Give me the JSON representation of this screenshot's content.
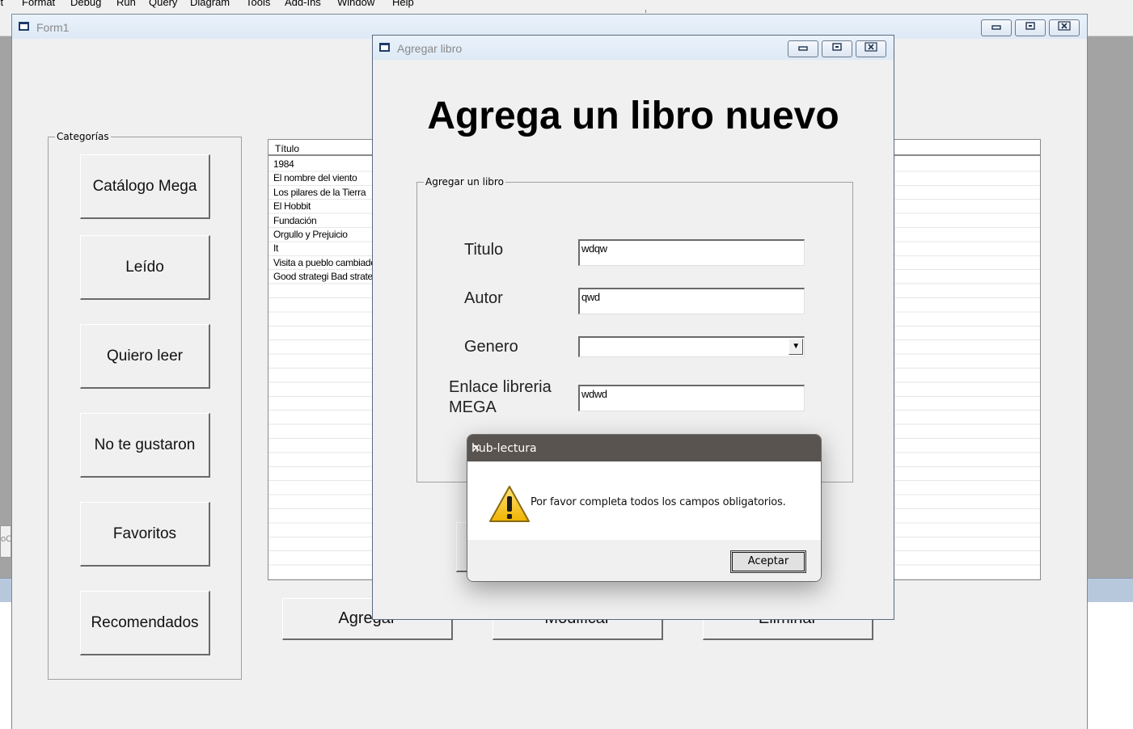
{
  "ide": {
    "menu": [
      {
        "label": "Format"
      },
      {
        "label": "Debug"
      },
      {
        "label": "Run"
      },
      {
        "label": "Query"
      },
      {
        "label": "Diagram"
      },
      {
        "label": "Tools"
      },
      {
        "label": "Add-Ins"
      },
      {
        "label": "Window"
      },
      {
        "label": "Help"
      }
    ]
  },
  "form1": {
    "title": "Form1",
    "categories": {
      "label": "Categorías",
      "buttons": [
        {
          "label": "Catálogo Mega"
        },
        {
          "label": "Leído"
        },
        {
          "label": "Quiero leer"
        },
        {
          "label": "No te gustaron"
        },
        {
          "label": "Favoritos"
        },
        {
          "label": "Recomendados"
        }
      ]
    },
    "list": {
      "header": "Título",
      "rows": [
        "1984",
        "El nombre del viento",
        "Los pilares de la Tierra",
        "El Hobbit",
        "Fundación",
        "Orgullo y Prejuicio",
        "It",
        "Visita a pueblo cambiado",
        "Good strategi Bad strategi"
      ]
    },
    "actions": {
      "add": "Agregar",
      "modify": "Modificar",
      "delete": "Eliminar"
    }
  },
  "dialog": {
    "title": "Agregar libro",
    "heading": "Agrega un libro nuevo",
    "group_label": "Agregar un libro",
    "fields": {
      "titulo": {
        "label": "Titulo",
        "value": "wdqw"
      },
      "autor": {
        "label": "Autor",
        "value": "qwd"
      },
      "genero": {
        "label": "Genero",
        "value": ""
      },
      "enlace": {
        "label_line1": "Enlace libreria",
        "label_line2": "MEGA",
        "value": "wdwd"
      }
    }
  },
  "msgbox": {
    "title": "hub-lectura",
    "close": "✕",
    "message": "Por favor completa todos los campos obligatorios.",
    "ok": "Aceptar",
    "icon": "warning-icon"
  },
  "title_buttons": {
    "minimize": "▭",
    "maximize": "▣",
    "close": "☒"
  }
}
